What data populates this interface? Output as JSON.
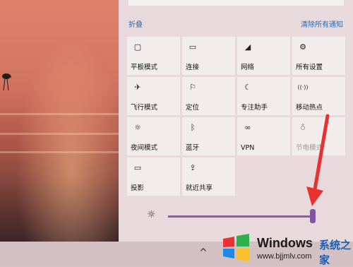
{
  "action_center": {
    "collapse_label": "折叠",
    "clear_all_label": "清除所有通知",
    "tiles": [
      {
        "label": "平板模式",
        "icon": "tablet-mode-icon",
        "glyph": "▢",
        "enabled": true
      },
      {
        "label": "连接",
        "icon": "connect-icon",
        "glyph": "▭",
        "enabled": true
      },
      {
        "label": "网络",
        "icon": "network-icon",
        "glyph": "◢",
        "enabled": true
      },
      {
        "label": "所有设置",
        "icon": "gear-icon",
        "glyph": "⚙",
        "enabled": true
      },
      {
        "label": "飞行模式",
        "icon": "airplane-icon",
        "glyph": "✈",
        "enabled": true
      },
      {
        "label": "定位",
        "icon": "location-icon",
        "glyph": "⚐",
        "enabled": true
      },
      {
        "label": "专注助手",
        "icon": "moon-icon",
        "glyph": "☾",
        "enabled": true
      },
      {
        "label": "移动热点",
        "icon": "hotspot-icon",
        "glyph": "((·))",
        "enabled": true
      },
      {
        "label": "夜间模式",
        "icon": "brightness-icon",
        "glyph": "☼",
        "enabled": true
      },
      {
        "label": "蓝牙",
        "icon": "bluetooth-icon",
        "glyph": "ᛒ",
        "enabled": true
      },
      {
        "label": "VPN",
        "icon": "vpn-icon",
        "glyph": "∞",
        "enabled": true
      },
      {
        "label": "节电模式",
        "icon": "battery-saver-icon",
        "glyph": "♁",
        "enabled": false
      },
      {
        "label": "投影",
        "icon": "project-icon",
        "glyph": "▭",
        "enabled": true
      },
      {
        "label": "就近共享",
        "icon": "nearby-share-icon",
        "glyph": "⇪",
        "enabled": true
      }
    ],
    "brightness_level": 1.0
  },
  "taskbar": {
    "chevron_glyph": "^"
  },
  "watermark": {
    "brand": "Windows",
    "brand_cn": "系统之家",
    "url": "www.bjjmlv.com"
  },
  "colors": {
    "link": "#2b6cb0",
    "slider": "#8b5aa8",
    "annotation_arrow": "#e8322f"
  }
}
